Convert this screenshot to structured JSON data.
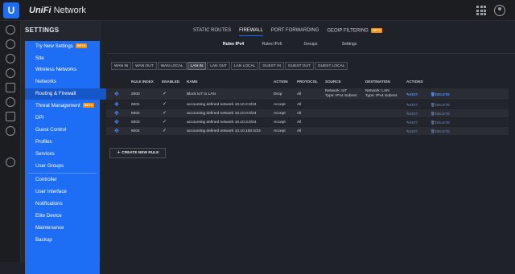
{
  "app": {
    "logo_letter": "U",
    "brand_prefix": "UniFi",
    "brand_suffix": "Network",
    "accent": "#1e6ef5"
  },
  "top_icons": [
    "apps-grid-icon",
    "user-avatar-icon"
  ],
  "iconbar": [
    "dashboard-icon",
    "statistics-icon",
    "map-icon",
    "devices-icon",
    "clients-icon",
    "insights-icon",
    "events-icon",
    "alerts-icon",
    "settings-icon"
  ],
  "sidebar": {
    "title": "SETTINGS",
    "items": [
      {
        "label": "Try New Settings",
        "beta": "BETA"
      },
      {
        "label": "Site"
      },
      {
        "label": "Wireless Networks"
      },
      {
        "label": "Networks"
      },
      {
        "label": "Routing & Firewall",
        "active": true
      },
      {
        "label": "Threat Management",
        "beta": "BETA"
      },
      {
        "label": "DPI"
      },
      {
        "label": "Guest Control"
      },
      {
        "label": "Profiles"
      },
      {
        "label": "Services"
      },
      {
        "label": "User Groups"
      },
      {
        "label": "Controller"
      },
      {
        "label": "User Interface"
      },
      {
        "label": "Notifications"
      },
      {
        "label": "Elite Device"
      },
      {
        "label": "Maintenance"
      },
      {
        "label": "Backup"
      }
    ]
  },
  "tabs": [
    {
      "label": "STATIC ROUTES"
    },
    {
      "label": "FIREWALL",
      "active": true
    },
    {
      "label": "PORT FORWARDING"
    },
    {
      "label": "GEOIP FILTERING",
      "beta": "BETA"
    }
  ],
  "subtabs": [
    {
      "label": "Rules IPv4",
      "active": true
    },
    {
      "label": "Rules IPv6"
    },
    {
      "label": "Groups"
    },
    {
      "label": "Settings"
    }
  ],
  "filters": [
    {
      "label": "WAN IN"
    },
    {
      "label": "WAN OUT"
    },
    {
      "label": "WAN LOCAL"
    },
    {
      "label": "LAN IN",
      "active": true
    },
    {
      "label": "LAN OUT"
    },
    {
      "label": "LAN LOCAL"
    },
    {
      "label": "GUEST IN"
    },
    {
      "label": "GUEST OUT"
    },
    {
      "label": "GUEST LOCAL"
    }
  ],
  "table": {
    "headers": [
      "RULE INDEX",
      "ENABLED",
      "NAME",
      "ACTION",
      "PROTOCOL",
      "SOURCE",
      "DESTINATION",
      "ACTIONS"
    ],
    "rows": [
      {
        "index": "2000",
        "enabled": "✓",
        "name": "Block IoT to LAN",
        "action": "Drop",
        "protocol": "All",
        "source_1": "Network: IoT",
        "source_2": "Type: IPv4 Subnet",
        "dest_1": "Network: LAN",
        "dest_2": "Type: IPv4 Subnet",
        "edit": "EDIT",
        "delete": "DELETE",
        "editable": true
      },
      {
        "index": "6001",
        "enabled": "✓",
        "name": "accounting defined network 10.10.2.0/24",
        "action": "Accept",
        "protocol": "All",
        "source_1": "",
        "source_2": "",
        "dest_1": "",
        "dest_2": "",
        "edit": "EDIT",
        "delete": "DELETE",
        "editable": false
      },
      {
        "index": "6002",
        "enabled": "✓",
        "name": "accounting defined network 10.10.0.0/24",
        "action": "Accept",
        "protocol": "All",
        "source_1": "",
        "source_2": "",
        "dest_1": "",
        "dest_2": "",
        "edit": "EDIT",
        "delete": "DELETE",
        "editable": false
      },
      {
        "index": "6003",
        "enabled": "✓",
        "name": "accounting defined network 10.10.3.0/24",
        "action": "Accept",
        "protocol": "All",
        "source_1": "",
        "source_2": "",
        "dest_1": "",
        "dest_2": "",
        "edit": "EDIT",
        "delete": "DELETE",
        "editable": false
      },
      {
        "index": "6004",
        "enabled": "✓",
        "name": "accounting defined network 10.10.100.0/24",
        "action": "Accept",
        "protocol": "All",
        "source_1": "",
        "source_2": "",
        "dest_1": "",
        "dest_2": "",
        "edit": "EDIT",
        "delete": "DELETE",
        "editable": false
      }
    ]
  },
  "create_button": {
    "label": "CREATE NEW RULE"
  }
}
